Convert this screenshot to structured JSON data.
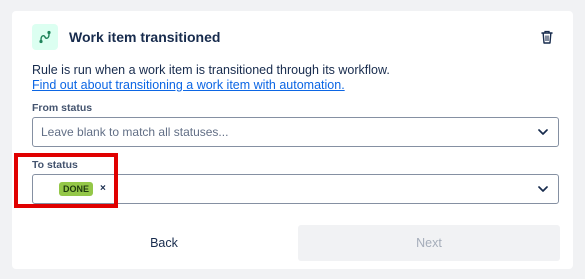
{
  "header": {
    "title": "Work item transitioned",
    "trigger_icon": "transition-icon",
    "delete_icon": "trash-icon"
  },
  "description": "Rule is run when a work item is transitioned through its workflow.",
  "help_link": "Find out about transitioning a work item with automation.",
  "from_status": {
    "label": "From status",
    "placeholder": "Leave blank to match all statuses..."
  },
  "to_status": {
    "label": "To status",
    "selected": [
      {
        "label": "DONE",
        "color": "#94c748"
      }
    ],
    "remove_glyph": "×"
  },
  "actions": {
    "back_label": "Back",
    "next_label": "Next",
    "next_disabled": true
  },
  "colors": {
    "accent_link": "#0c66e4",
    "trigger_icon_bg": "#dcfff1",
    "trigger_icon_fg": "#1f845a",
    "highlight": "#e00000"
  }
}
